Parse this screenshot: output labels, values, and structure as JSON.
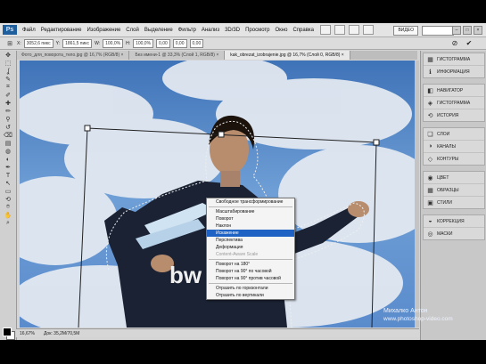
{
  "app": {
    "logo": "Ps"
  },
  "menubar": {
    "items": [
      "Файл",
      "Редактирование",
      "Изображение",
      "Слой",
      "Выделение",
      "Фильтр",
      "Анализ",
      "3D/3D",
      "Просмотр",
      "Окно",
      "Справка"
    ],
    "workspace_label": "ВИДЕО",
    "window_buttons": [
      "–",
      "□",
      "×"
    ]
  },
  "optbar": {
    "x_value": "3052,6 пикс",
    "y_value": "1861,5 пикс",
    "w_value": "100,0%",
    "h_value": "100,0%",
    "angle_value": "0,00",
    "h_skew": "0,00",
    "v_skew": "0,00",
    "x_label": "X:",
    "y_label": "Y:",
    "w_label": "W:",
    "h_label": "H:",
    "commit_icon": "check-icon",
    "cancel_icon": "cancel-icon"
  },
  "tabs": [
    {
      "label": "Фото_для_поворота_тело.jpg @ 16,7% (RGB/8) ×",
      "active": false
    },
    {
      "label": "Без имени-1 @ 33,3% (Слой 1, RGB/8) ×",
      "active": false
    },
    {
      "label": "kak_obrezat_izobrajenie.jpg @ 16,7% (Слой 0, RGB/8) ×",
      "active": true
    }
  ],
  "toolbox": {
    "icons": [
      "move-icon",
      "marquee-icon",
      "lasso-icon",
      "quick-select-icon",
      "crop-icon",
      "eyedropper-icon",
      "healing-icon",
      "brush-icon",
      "stamp-icon",
      "history-brush-icon",
      "eraser-icon",
      "gradient-icon",
      "blur-icon",
      "dodge-icon",
      "pen-icon",
      "type-icon",
      "path-select-icon",
      "shape-icon",
      "3d-rotate-icon",
      "3d-camera-icon",
      "hand-icon",
      "zoom-icon"
    ],
    "glyphs": [
      "✥",
      "⬚",
      "ʆ",
      "✎",
      "⌗",
      "✐",
      "✚",
      "✏",
      "⚲",
      "↺",
      "⌫",
      "▤",
      "◍",
      "◐",
      "✒",
      "T",
      "↖",
      "▭",
      "⟲",
      "⌾",
      "✋",
      "⌕"
    ]
  },
  "context_menu": {
    "items": [
      {
        "label": "Свободное трансформирование",
        "state": "normal"
      },
      {
        "sep": true
      },
      {
        "label": "Масштабирование",
        "state": "normal"
      },
      {
        "label": "Поворот",
        "state": "normal"
      },
      {
        "label": "Наклон",
        "state": "normal"
      },
      {
        "label": "Искажение",
        "state": "highlighted"
      },
      {
        "label": "Перспектива",
        "state": "normal"
      },
      {
        "label": "Деформация",
        "state": "normal"
      },
      {
        "label": "Content-Aware Scale",
        "state": "disabled"
      },
      {
        "sep": true
      },
      {
        "label": "Поворот на 180°",
        "state": "normal"
      },
      {
        "label": "Поворот на 90° по часовой",
        "state": "normal"
      },
      {
        "label": "Поворот на 90° против часовой",
        "state": "normal"
      },
      {
        "sep": true
      },
      {
        "label": "Отразить по горизонтали",
        "state": "normal"
      },
      {
        "label": "Отразить по вертикали",
        "state": "normal"
      }
    ]
  },
  "panels": {
    "groups": [
      [
        {
          "icon": "histogram-icon",
          "glyph": "▦",
          "label": "Гистограмма"
        },
        {
          "icon": "info-icon",
          "glyph": "ℹ",
          "label": "Информация"
        }
      ],
      [
        {
          "icon": "navigator-icon",
          "glyph": "◧",
          "label": "Навигатор"
        },
        {
          "icon": "color-palette-icon",
          "glyph": "◈",
          "label": "Гистограмма"
        },
        {
          "icon": "history-icon",
          "glyph": "⟲",
          "label": "История"
        }
      ],
      [
        {
          "icon": "layers-icon",
          "glyph": "❏",
          "label": "Слои"
        },
        {
          "icon": "channels-icon",
          "glyph": "◑",
          "label": "Каналы"
        },
        {
          "icon": "paths-icon",
          "glyph": "◇",
          "label": "Контуры"
        }
      ],
      [
        {
          "icon": "color-icon",
          "glyph": "◉",
          "label": "Цвет"
        },
        {
          "icon": "swatches-icon",
          "glyph": "▦",
          "label": "Образцы"
        },
        {
          "icon": "styles-icon",
          "glyph": "▣",
          "label": "Стили"
        }
      ],
      [
        {
          "icon": "adjustments-icon",
          "glyph": "◒",
          "label": "Коррекция"
        },
        {
          "icon": "masks-icon",
          "glyph": "◎",
          "label": "Маски"
        }
      ]
    ]
  },
  "status": {
    "zoom": "16,67%",
    "doc_size": "Док: 35,2M/70,5M"
  },
  "watermark": {
    "name": "Михалко Антон",
    "url": "www.photoshop-video.com"
  },
  "canvas": {
    "jersey_text": "bw"
  }
}
